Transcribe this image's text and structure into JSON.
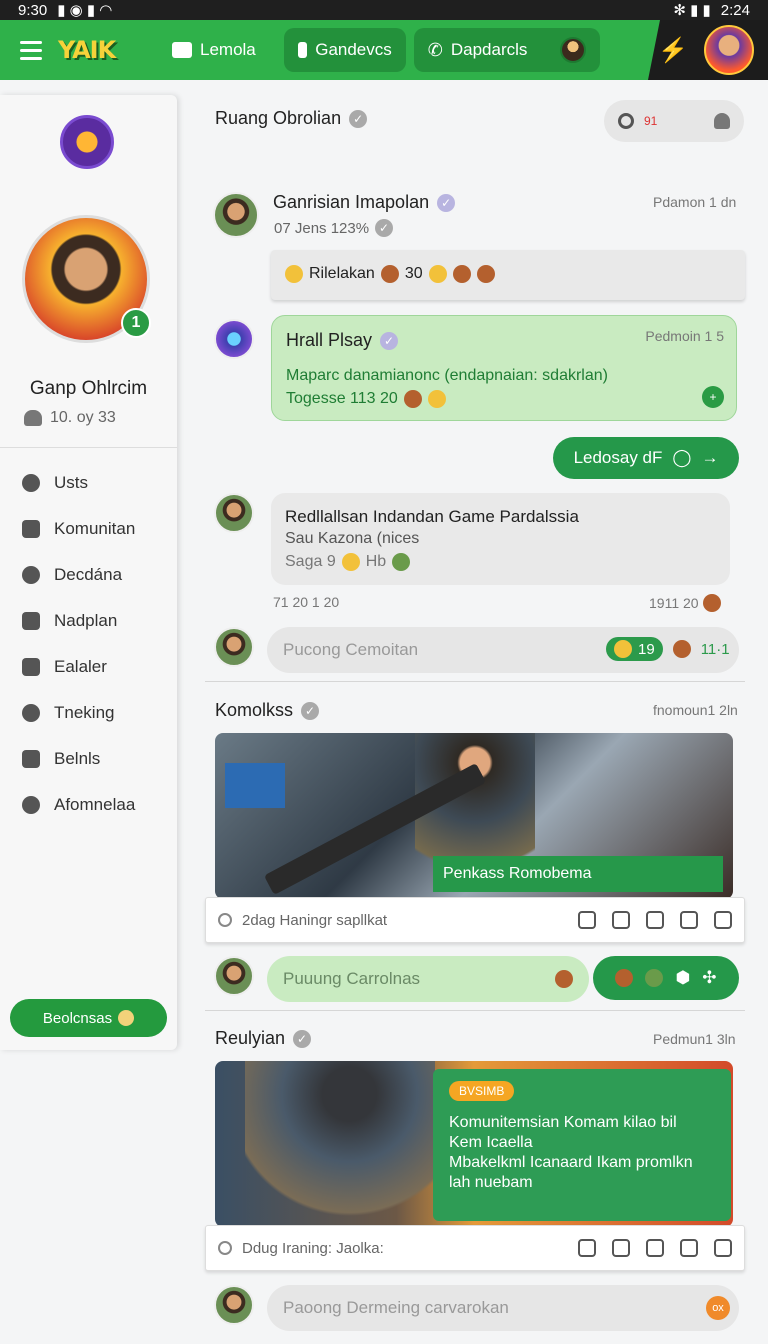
{
  "statusbar": {
    "time": "9:30",
    "right": "2:24"
  },
  "topnav": {
    "tabs": [
      {
        "label": "Lemola"
      },
      {
        "label": "Gandevcs"
      },
      {
        "label": "Dapdarcls"
      }
    ],
    "logo_text": "YAIK"
  },
  "sidebar": {
    "level": "1",
    "name": "Ganp Ohlrcim",
    "stat": "10. oy 33",
    "menu": [
      {
        "label": "Usts"
      },
      {
        "label": "Komunitan"
      },
      {
        "label": "Decdána"
      },
      {
        "label": "Nadplan"
      },
      {
        "label": "Ealaler"
      },
      {
        "label": "Tneking"
      },
      {
        "label": "Belnls"
      },
      {
        "label": "Afomnelaa"
      }
    ],
    "button_label": "Beolcnsas"
  },
  "room": {
    "title": "Ruang Obrolian",
    "search_text": "91"
  },
  "messages": [
    {
      "name": "Ganrisian Imapolan",
      "sub": "07 Jens 123%",
      "time": "Pdamon 1 dn",
      "bubble_text": "Rilelakan",
      "bubble_num": "30"
    },
    {
      "name": "Hrall Plsay",
      "time": "Pedmoin 1 5",
      "line1": "Maparc danamianonc (endapnaian: sdakrlan)",
      "line2": "Togesse 113 20"
    },
    {
      "pill_label": "Ledosay dF"
    },
    {
      "title": "Redllallsan Indandan Game Pardalssia",
      "line1": "Sau Kazona (nices",
      "line2": "Saga 9",
      "line2b": "Hb",
      "time_left": "71 20 1 20",
      "time_right": "1911 20"
    }
  ],
  "composer1": {
    "placeholder": "Pucong Cemoitan",
    "chip": "19",
    "extra": "11·1"
  },
  "post1": {
    "title": "Komolkss",
    "time": "fnomoun1 2ln",
    "image_label": "Penkass Romobema",
    "caption": "2dag  Haningr sapllkat"
  },
  "composer2": {
    "placeholder": "Puuung Carrolnas"
  },
  "post2": {
    "title": "Reulyian",
    "time": "Pedmun1 3ln",
    "tag": "BVSIMB",
    "card_lines": [
      "Komunitemsian Komam kilao bil",
      "Kem Icaella",
      "Mbakelkml Icanaard Ikam promlkn",
      "lah nuebam"
    ],
    "caption": "Ddug  Iraning: Jaolka:"
  },
  "composer3": {
    "placeholder": "Paoong Dermeing carvarokan",
    "dot": "ox"
  },
  "colors": {
    "brand": "#2fb14a",
    "accent_dark": "#25984a"
  }
}
